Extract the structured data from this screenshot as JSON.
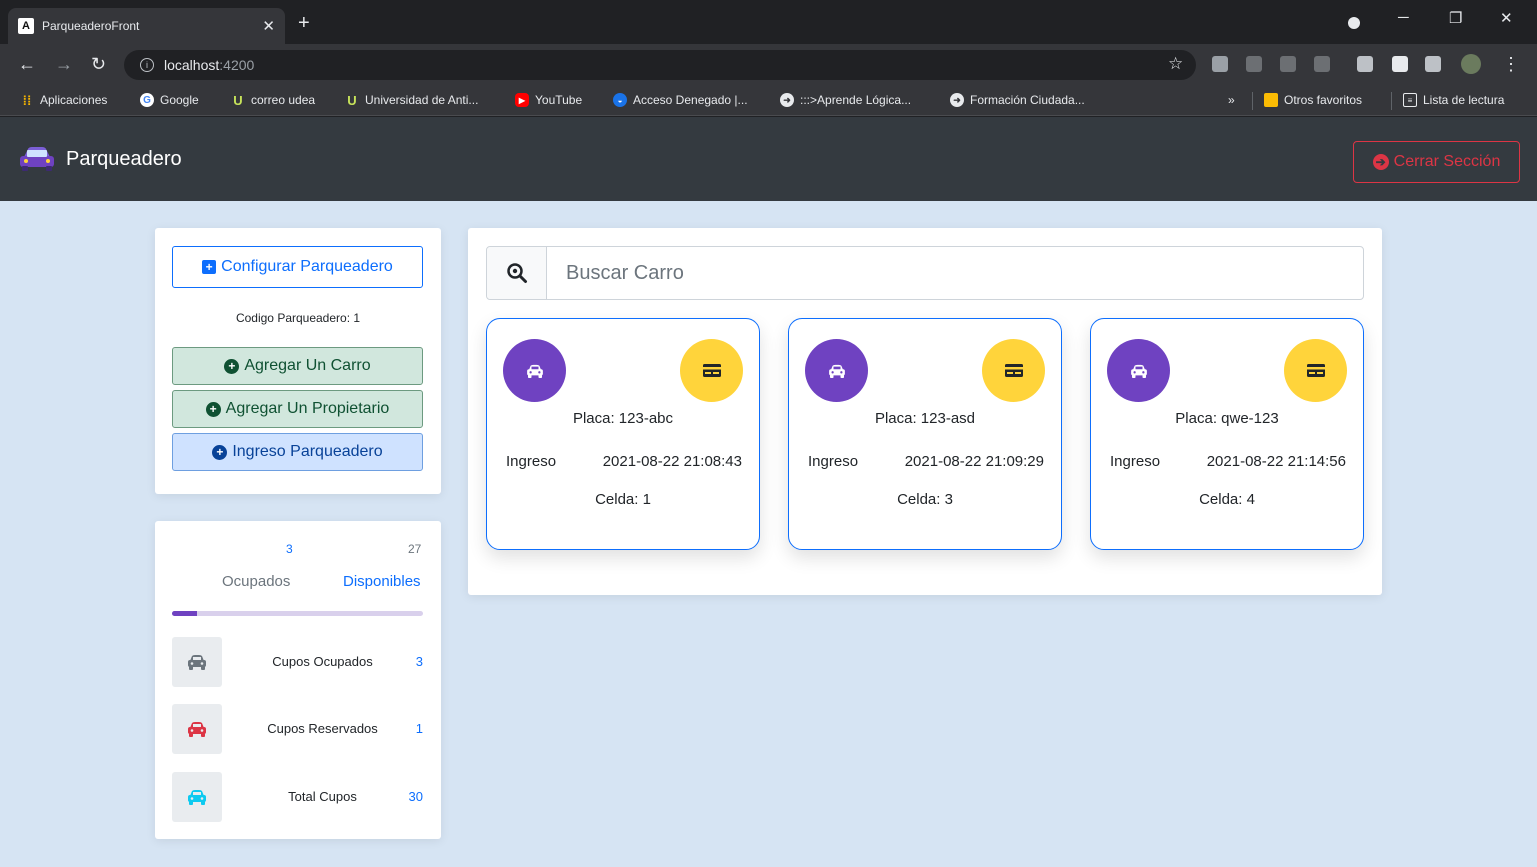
{
  "browser": {
    "tab_title": "ParqueaderoFront",
    "favicon_letter": "A",
    "url_host": "localhost",
    "url_port": ":4200",
    "bookmarks": [
      {
        "label": "Aplicaciones",
        "icon": "apps-grid-icon"
      },
      {
        "label": "Google",
        "icon": "google-icon"
      },
      {
        "label": "correo udea",
        "icon": "udea-icon"
      },
      {
        "label": "Universidad de Anti...",
        "icon": "udea-icon"
      },
      {
        "label": "YouTube",
        "icon": "youtube-icon"
      },
      {
        "label": "Acceso Denegado |...",
        "icon": "globe-icon"
      },
      {
        "label": ":::>Aprende Lógica...",
        "icon": "globe-icon"
      },
      {
        "label": "Formación Ciudada...",
        "icon": "globe-icon"
      }
    ],
    "other_favorites": "Otros favoritos",
    "reading_list": "Lista de lectura"
  },
  "app": {
    "brand": "Parqueadero",
    "logout_label": "Cerrar Sección"
  },
  "sidebar": {
    "configure_label": "Configurar Parqueadero",
    "code_label": "Codigo Parqueadero: 1",
    "add_car_label": "Agregar Un Carro",
    "add_owner_label": "Agregar Un Propietario",
    "entry_label": "Ingreso Parqueadero"
  },
  "stats": {
    "occupied_count": "3",
    "available_count": "27",
    "occupied_label": "Ocupados",
    "available_label": "Disponibles",
    "occupancy_fraction": 0.1,
    "rows": [
      {
        "label": "Cupos Ocupados",
        "value": "3",
        "color": "#6c757d"
      },
      {
        "label": "Cupos Reservados",
        "value": "1",
        "color": "#dc3545"
      },
      {
        "label": "Total Cupos",
        "value": "30",
        "color": "#0dcaf0"
      }
    ]
  },
  "search": {
    "placeholder": "Buscar Carro"
  },
  "cars": [
    {
      "plate": "Placa: 123-abc",
      "entry_label": "Ingreso",
      "entry_time": "2021-08-22 21:08:43",
      "cell": "Celda: 1"
    },
    {
      "plate": "Placa: 123-asd",
      "entry_label": "Ingreso",
      "entry_time": "2021-08-22 21:09:29",
      "cell": "Celda: 3"
    },
    {
      "plate": "Placa: qwe-123",
      "entry_label": "Ingreso",
      "entry_time": "2021-08-22 21:14:56",
      "cell": "Celda: 4"
    }
  ],
  "colors": {
    "navbar": "#343a40",
    "background": "#d6e4f3",
    "purple": "#6f42c1",
    "yellow": "#ffd43b",
    "primary": "#0d6efd",
    "danger": "#dc3545"
  }
}
